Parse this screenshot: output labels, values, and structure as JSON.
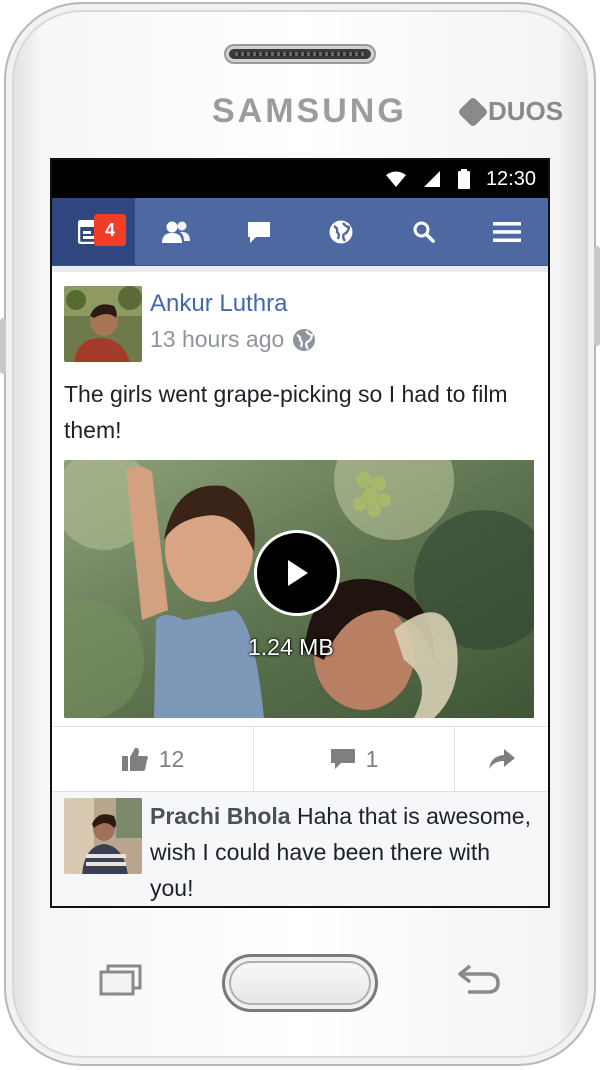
{
  "device": {
    "brand": "SAMSUNG",
    "model_badge": "DUOS"
  },
  "statusbar": {
    "time": "12:30",
    "icons": [
      "wifi-icon",
      "signal-icon",
      "battery-icon"
    ]
  },
  "navbar": {
    "items": [
      {
        "name": "news-feed",
        "icon": "news-feed-icon",
        "badge": "4",
        "active": true
      },
      {
        "name": "friends",
        "icon": "friends-icon"
      },
      {
        "name": "messages",
        "icon": "chat-icon"
      },
      {
        "name": "notifications",
        "icon": "globe-icon"
      },
      {
        "name": "search",
        "icon": "search-icon"
      },
      {
        "name": "menu",
        "icon": "hamburger-icon"
      }
    ],
    "colors": {
      "bar": "#4e69a2",
      "active": "#2f4680",
      "badge": "#f03d25"
    }
  },
  "post": {
    "author": "Ankur Luthra",
    "timestamp": "13 hours ago",
    "privacy_icon": "globe-icon",
    "text": "The girls went grape-picking so I had to film them!",
    "video": {
      "size": "1.24 MB",
      "play_icon": "play-icon"
    },
    "actions": {
      "likes": "12",
      "comments": "1"
    }
  },
  "comment": {
    "author": "Prachi Bhola",
    "text": "Haha that is awesome, wish I could have been there with you!"
  }
}
